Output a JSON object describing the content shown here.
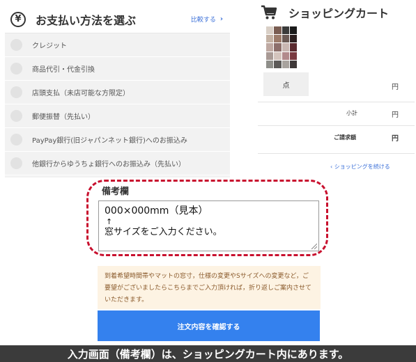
{
  "payment": {
    "title": "お支払い方法を選ぶ",
    "compare_link": "比較する",
    "methods": [
      {
        "label": "クレジット"
      },
      {
        "label": "商品代引・代金引換"
      },
      {
        "label": "店頭支払（未店可能な方限定）"
      },
      {
        "label": "郵便振替（先払い）"
      },
      {
        "label": "PayPay銀行(旧ジャパンネット銀行)へのお振込み"
      },
      {
        "label": "他銀行からゆうちょ銀行へのお振込み（先払い）"
      }
    ]
  },
  "cart": {
    "title": "ショッピングカート",
    "qty_unit": "点",
    "yen": "円",
    "subtotal_label": "小計",
    "total_label": "ご請求額",
    "continue_link": "ショッピングを続ける",
    "swatch_colors": [
      "#d9cfc6",
      "#7a5d52",
      "#3a3a3a",
      "#1a1a1a",
      "#c4b2a4",
      "#9c7b6a",
      "#6b5a55",
      "#2b1e1e",
      "#bfa9a2",
      "#8d6f6b",
      "#c9b7b2",
      "#5a2a2f",
      "#a99a95",
      "#d4c4bd",
      "#b28a8c",
      "#7a3a40",
      "#8f8f8a",
      "#5c5a58",
      "#a8a39e",
      "#3e3838"
    ]
  },
  "remarks": {
    "label": "備考欄",
    "line1": "000×000mm（見本）",
    "line2": "↑",
    "line3": "窓サイズをご入力ください。"
  },
  "notice": {
    "text": "到着希望時間帯やマットの窓寸，仕様の変更やSサイズへの変更など，ご要望がございましたらこちらまでご入力頂ければ，折り返しご案内させていただきます。"
  },
  "confirm_button": "注文内容を確認する",
  "caption": "入力画面（備考欄）は、ショッピングカート内にあります。",
  "colors": {
    "accent_blue": "#3481ee",
    "highlight_red": "#c8102e",
    "notice_bg": "#fdf3e3",
    "caption_bg": "#3b3b3b"
  }
}
